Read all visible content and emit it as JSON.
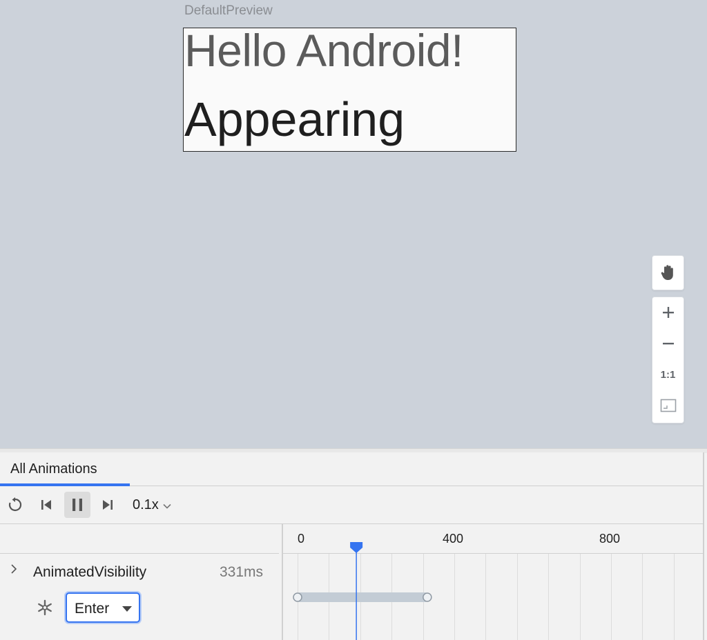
{
  "preview": {
    "label": "DefaultPreview",
    "hello_text": "Hello Android!",
    "status_text": "Appearing"
  },
  "zoom_tools": {
    "actual_size_label": "1:1"
  },
  "animation_inspector": {
    "tab_label": "All Animations",
    "speed": "0.1x",
    "timeline_ticks": [
      "0",
      "400",
      "800"
    ],
    "timeline_max_ms": 1000,
    "playhead_ms": 150,
    "transition_start_ms": 0,
    "transition_end_ms": 331,
    "animation": {
      "name": "AnimatedVisibility",
      "duration": "331ms",
      "state": "Enter"
    }
  },
  "colors": {
    "accent": "#3574f0",
    "preview_bg": "#ccd2da",
    "transition_bar": "#c3ccd5"
  }
}
